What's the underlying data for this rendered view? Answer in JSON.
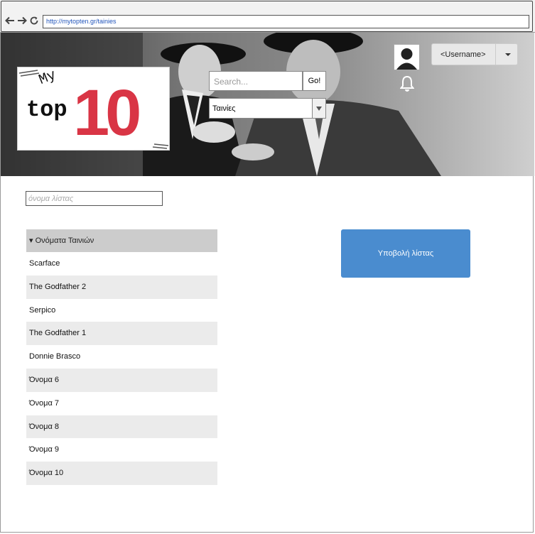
{
  "browser": {
    "url": "http://mytopten.gr/tainies",
    "back_icon": "arrow-left-icon",
    "forward_icon": "arrow-right-icon",
    "reload_icon": "reload-icon"
  },
  "header": {
    "logo": {
      "line1": "My",
      "line2": "top",
      "line3": "10"
    },
    "search": {
      "placeholder": "Search...",
      "button_label": "Go!"
    },
    "category": {
      "selected": "Ταινίες"
    },
    "user": {
      "label": "<Username>"
    },
    "notifications_icon": "bell-icon",
    "avatar_icon": "user-avatar-icon"
  },
  "main": {
    "list_name": {
      "placeholder": "όνομα λίστας"
    },
    "movies": {
      "header": "▾ Ονόματα Ταινιών",
      "items": [
        "Scarface",
        "The Godfather 2",
        "Serpico",
        "The Godfather 1",
        "Donnie Brasco",
        "Όνομα 6",
        "Όνομα 7",
        "Όνομα 8",
        "Όνομα 9",
        "Όνομα 10"
      ]
    },
    "submit_label": "Υποβολή λίστας"
  },
  "colors": {
    "accent": "#4a8ccf",
    "logo_red": "#d93545",
    "row_alt": "#ebebeb",
    "header_row": "#cccccc"
  }
}
